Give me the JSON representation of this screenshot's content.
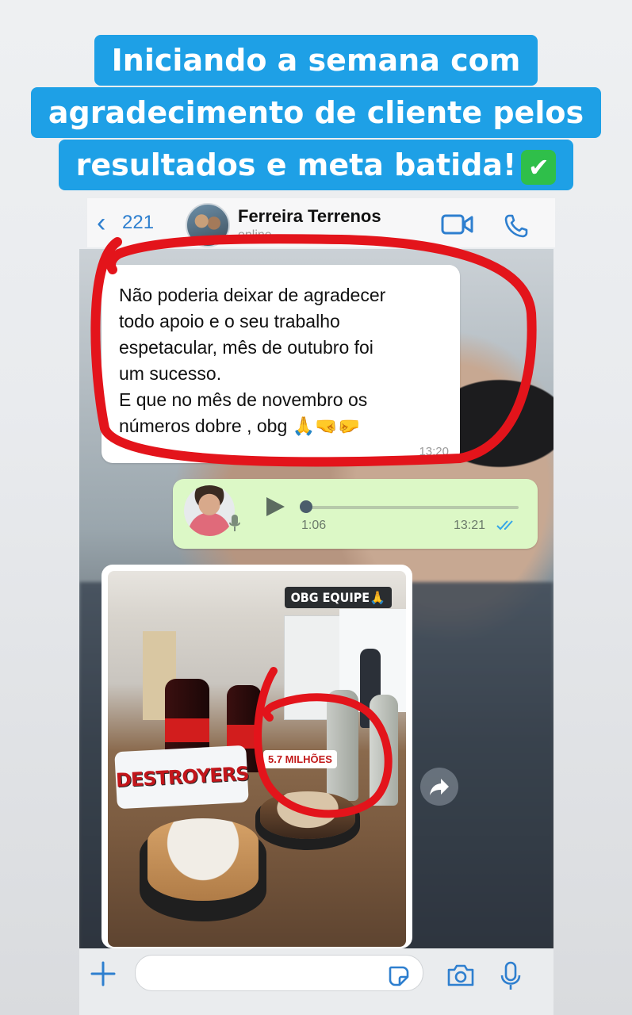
{
  "caption": {
    "line1": "Iniciando a semana com",
    "line2": "agradecimento de cliente pelos",
    "line3": "resultados e meta batida!",
    "emoji": "✔"
  },
  "header": {
    "back_count": "221",
    "contact_name": "Ferreira Terrenos",
    "status": "online",
    "video_icon": "video-call-icon",
    "call_icon": "phone-icon"
  },
  "messages": {
    "incoming": {
      "lines": [
        "Não poderia deixar de agradecer",
        "todo apoio e o seu trabalho",
        "espetacular, mês de outubro foi",
        "um sucesso.",
        "E que no mês de novembro  os",
        "números dobre  , obg 🙏🤜🤛"
      ],
      "time": "13:20"
    },
    "voice": {
      "duration": "1:06",
      "time": "13:21",
      "progress": 0
    },
    "photo": {
      "caption": "OBG EQUIPE🙏",
      "sign_text": "DESTROYERS",
      "label": "5.7 MILHÕES"
    }
  },
  "input": {
    "placeholder": ""
  },
  "colors": {
    "accent": "#1ea0e6",
    "annotation": "#e3141b",
    "outgoing_bubble": "#dcf8c6"
  }
}
